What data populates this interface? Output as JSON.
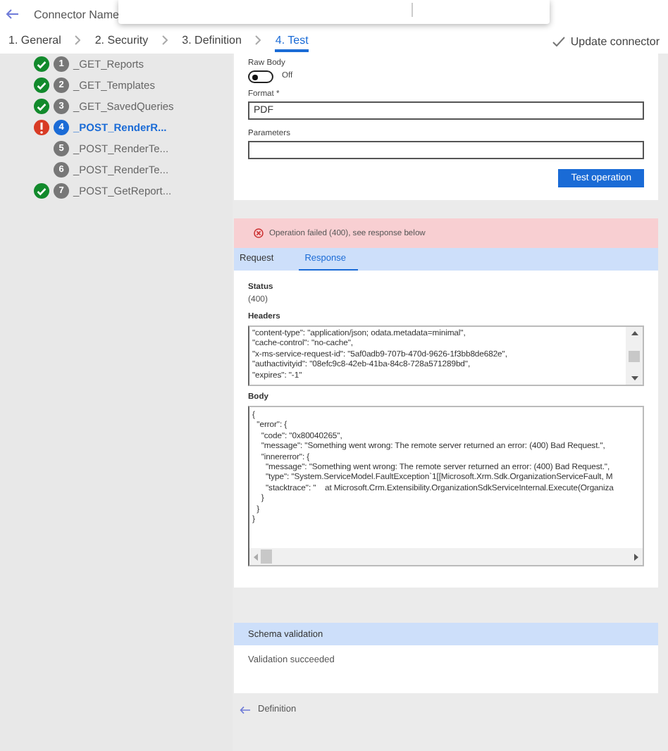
{
  "header": {
    "title": "Connector Name"
  },
  "steps": [
    {
      "label": "1. General",
      "selected": false
    },
    {
      "label": "2. Security",
      "selected": false
    },
    {
      "label": "3. Definition",
      "selected": false
    },
    {
      "label": "4. Test",
      "selected": true
    }
  ],
  "update_button": "Update connector",
  "operations": [
    {
      "number": "1",
      "label": "_GET_Reports",
      "kind": "ok",
      "selected": false
    },
    {
      "number": "2",
      "label": "_GET_Templates",
      "kind": "ok",
      "selected": false
    },
    {
      "number": "3",
      "label": "_GET_SavedQueries",
      "kind": "ok",
      "selected": false
    },
    {
      "number": "4",
      "label": "_POST_RenderR...",
      "kind": "error",
      "selected": true
    },
    {
      "number": "5",
      "label": "_POST_RenderTe...",
      "kind": "untested",
      "selected": false
    },
    {
      "number": "6",
      "label": "_POST_RenderTe...",
      "kind": "untested",
      "selected": false
    },
    {
      "number": "7",
      "label": "_POST_GetReport...",
      "kind": "ok",
      "selected": false
    }
  ],
  "test_form": {
    "raw_body": {
      "label": "Raw Body",
      "on": false,
      "state_text": "Off"
    },
    "format": {
      "label": "Format *",
      "value": "PDF"
    },
    "parameters": {
      "label": "Parameters"
    },
    "button": "Test operation"
  },
  "result": {
    "banner": "Operation failed (400), see response below",
    "tabs": [
      {
        "label": "Request",
        "selected": false
      },
      {
        "label": "Response",
        "selected": true
      }
    ],
    "status_label": "Status",
    "status_value": "(400)",
    "headers_label": "Headers",
    "headers_lines": [
      "\"content-type\": \"application/json; odata.metadata=minimal\",",
      "\"cache-control\": \"no-cache\",",
      "\"x-ms-service-request-id\": \"5af0adb9-707b-470d-9626-1f3bb8de682e\",",
      "\"authactivityid\": \"08efc9c8-42eb-41ba-84c8-728a571289bd\",",
      "\"expires\": \"-1\""
    ],
    "body_label": "Body",
    "body_lines": [
      "{",
      "  \"error\": {",
      "    \"code\": \"0x80040265\",",
      "    \"message\": \"Something went wrong: The remote server returned an error: (400) Bad Request.\",",
      "    \"innererror\": {",
      "      \"message\": \"Something went wrong: The remote server returned an error: (400) Bad Request.\",",
      "      \"type\": \"System.ServiceModel.FaultException`1[[Microsoft.Xrm.Sdk.OrganizationServiceFault, M",
      "      \"stacktrace\": \"    at Microsoft.Crm.Extensibility.OrganizationSdkServiceInternal.Execute(Organiza",
      "    }",
      "  }",
      "}"
    ]
  },
  "schema": {
    "title": "Schema validation",
    "message": "Validation succeeded"
  },
  "footer_link": "Definition"
}
